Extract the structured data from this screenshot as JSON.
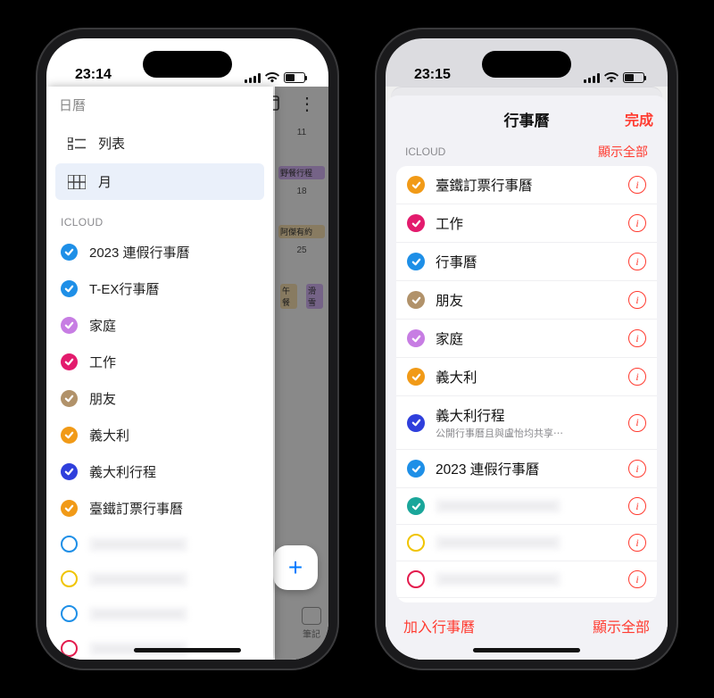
{
  "left": {
    "status_time": "23:14",
    "app_title": "日曆",
    "views": {
      "list_label": "列表",
      "month_label": "月"
    },
    "section_label": "ICLOUD",
    "calendars": [
      {
        "label": "2023 連假行事曆",
        "color": "#1e8fe7",
        "checked": true,
        "blurred": false
      },
      {
        "label": "T-EX行事曆",
        "color": "#1e8fe7",
        "checked": true,
        "blurred": false
      },
      {
        "label": "家庭",
        "color": "#c77de3",
        "checked": true,
        "blurred": false
      },
      {
        "label": "工作",
        "color": "#e31b6d",
        "checked": true,
        "blurred": false
      },
      {
        "label": "朋友",
        "color": "#b1926a",
        "checked": true,
        "blurred": false
      },
      {
        "label": "義大利",
        "color": "#f19a17",
        "checked": true,
        "blurred": false
      },
      {
        "label": "義大利行程",
        "color": "#2f3fdc",
        "checked": true,
        "blurred": false
      },
      {
        "label": "臺鐵訂票行事曆",
        "color": "#f19a17",
        "checked": true,
        "blurred": false
      },
      {
        "label": "",
        "color": "#1e8fe7",
        "checked": false,
        "blurred": true
      },
      {
        "label": "",
        "color": "#f0c400",
        "checked": false,
        "blurred": true
      },
      {
        "label": "",
        "color": "#1e8fe7",
        "checked": false,
        "blurred": true
      },
      {
        "label": "",
        "color": "#e31b4d",
        "checked": false,
        "blurred": true
      }
    ],
    "bg": {
      "day11": "11",
      "event11": "野餐行程",
      "day18": "18",
      "event18": "阿傑有約",
      "day25": "25",
      "event25a": "午餐",
      "event25b": "滑雪",
      "fab": "+",
      "chip_label": "筆記"
    }
  },
  "right": {
    "status_time": "23:15",
    "sheet_title": "行事曆",
    "done_label": "完成",
    "group_label": "ICLOUD",
    "group_action": "顯示全部",
    "bottom_left": "加入行事曆",
    "bottom_right": "顯示全部",
    "calendars": [
      {
        "label": "臺鐵訂票行事曆",
        "sublabel": "",
        "color": "#f19a17",
        "checked": true,
        "style": "filled",
        "blurred": false
      },
      {
        "label": "工作",
        "sublabel": "",
        "color": "#e31b6d",
        "checked": true,
        "style": "filled",
        "blurred": false
      },
      {
        "label": "行事曆",
        "sublabel": "",
        "color": "#1e8fe7",
        "checked": true,
        "style": "filled",
        "blurred": false
      },
      {
        "label": "朋友",
        "sublabel": "",
        "color": "#b1926a",
        "checked": true,
        "style": "filled",
        "blurred": false
      },
      {
        "label": "家庭",
        "sublabel": "",
        "color": "#c77de3",
        "checked": true,
        "style": "filled",
        "blurred": false
      },
      {
        "label": "義大利",
        "sublabel": "",
        "color": "#f19a17",
        "checked": true,
        "style": "filled",
        "blurred": false
      },
      {
        "label": "義大利行程",
        "sublabel": "公開行事曆且與盧怡均共享⋯",
        "color": "#2f3fdc",
        "checked": true,
        "style": "filled",
        "blurred": false
      },
      {
        "label": "2023 連假行事曆",
        "sublabel": "",
        "color": "#1e8fe7",
        "checked": true,
        "style": "filled",
        "blurred": false
      },
      {
        "label": "",
        "sublabel": "",
        "color": "#1aa69a",
        "checked": true,
        "style": "filled",
        "blurred": true
      },
      {
        "label": "",
        "sublabel": "",
        "color": "#f0c400",
        "checked": false,
        "style": "ring",
        "blurred": true
      },
      {
        "label": "",
        "sublabel": "",
        "color": "#e31b4d",
        "checked": false,
        "style": "ring",
        "blurred": true
      },
      {
        "label": "",
        "sublabel": "",
        "color": "#1e8fe7",
        "checked": true,
        "style": "filled",
        "blurred": true
      }
    ]
  }
}
